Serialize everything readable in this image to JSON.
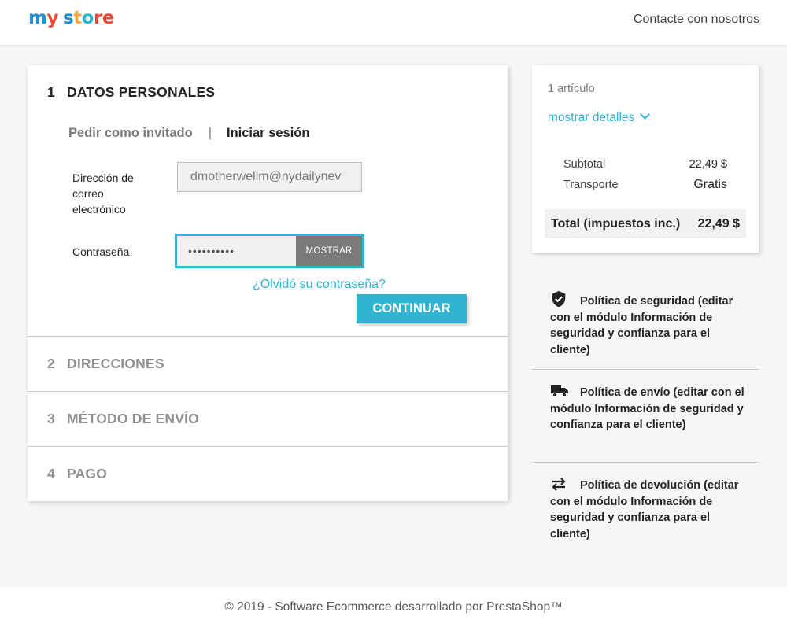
{
  "header": {
    "logo": {
      "parts": [
        "m",
        "y",
        " ",
        "s",
        "t",
        "o",
        "r",
        "e"
      ],
      "colors": [
        "#1e90cf",
        "#e84b3a",
        "#ffffff",
        "#1e90cf",
        "#f2a93b",
        "#2fb5d2",
        "#e84b3a",
        "#e84b3a"
      ]
    },
    "contact_label": "Contacte con nosotros"
  },
  "checkout": {
    "steps": [
      {
        "num": "1",
        "title": "DATOS PERSONALES",
        "current": true
      },
      {
        "num": "2",
        "title": "DIRECCIONES",
        "current": false
      },
      {
        "num": "3",
        "title": "MÉTODO DE ENVÍO",
        "current": false
      },
      {
        "num": "4",
        "title": "PAGO",
        "current": false
      }
    ],
    "tabs": {
      "guest": "Pedir como invitado",
      "separator": "|",
      "login": "Iniciar sesión"
    },
    "email": {
      "label": "Dirección de correo electrónico",
      "value": "dmotherwellm@nydailynev"
    },
    "password": {
      "label": "Contraseña",
      "value": "••••••••••",
      "show_label": "MOSTRAR"
    },
    "forgot_label": "¿Olvidó su contraseña?",
    "continue_label": "CONTINUAR"
  },
  "summary": {
    "count": "1 artículo",
    "details_label": "mostrar detalles",
    "subtotal_label": "Subtotal",
    "subtotal_value": "22,49 $",
    "shipping_label": "Transporte",
    "shipping_value": "Gratis",
    "total_label": "Total (impuestos inc.)",
    "total_value": "22,49 $"
  },
  "reassurance": [
    {
      "icon": "shield-check-icon",
      "text": "Política de seguridad (editar con el módulo Información de seguridad y confianza para el cliente)"
    },
    {
      "icon": "truck-icon",
      "text": "Política de envío (editar con el módulo Información de seguridad y confianza para el cliente)"
    },
    {
      "icon": "swap-arrows-icon",
      "text": "Política de devolución (editar con el módulo Información de seguridad y confianza para el cliente)"
    }
  ],
  "footer": {
    "copyright": "© 2019 - Software Ecommerce desarrollado por PrestaShop™"
  },
  "colors": {
    "accent": "#2fb5d2",
    "show_button": "#7a7a7a"
  }
}
